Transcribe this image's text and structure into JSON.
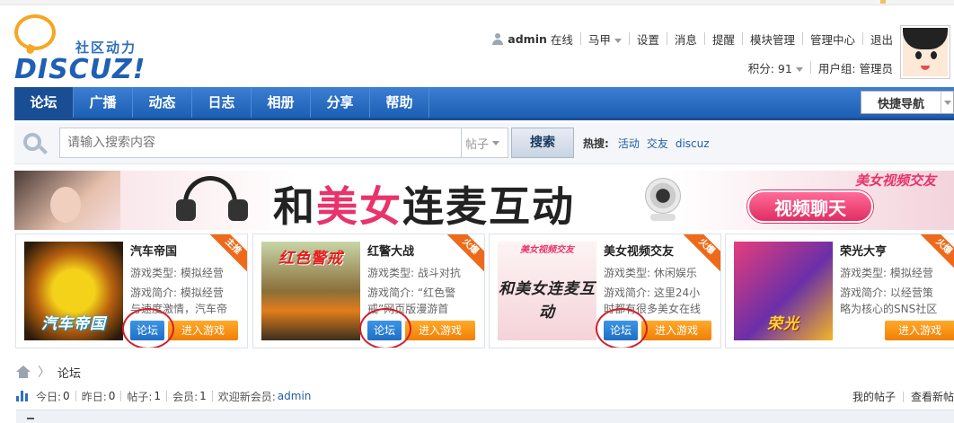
{
  "header": {
    "logo_slogan": "社区动力",
    "logo_word": "DISCUZ!",
    "user_nav": {
      "username": "admin",
      "online": "在线",
      "items": [
        {
          "label": "马甲",
          "dropdown": true
        },
        {
          "label": "设置"
        },
        {
          "label": "消息"
        },
        {
          "label": "提醒"
        },
        {
          "label": "模块管理"
        },
        {
          "label": "管理中心"
        },
        {
          "label": "退出"
        }
      ]
    },
    "credits_label": "积分: 91",
    "usergroup_label": "用户组: 管理员"
  },
  "nav": {
    "items": [
      "论坛",
      "广播",
      "动态",
      "日志",
      "相册",
      "分享",
      "帮助"
    ],
    "active_index": 0,
    "quick_nav": "快捷导航"
  },
  "search": {
    "placeholder": "请输入搜索内容",
    "type": "帖子",
    "button": "搜索",
    "hot_label": "热搜:",
    "hot_tags": [
      "活动",
      "交友",
      "discuz"
    ]
  },
  "banner": {
    "headline_a": "和",
    "headline_accent": "美女",
    "headline_b": "连麦互动",
    "tag": "美女视频交友",
    "pill": "视频聊天"
  },
  "games": [
    {
      "title": "汽车帝国",
      "badge": "主推",
      "thumb_text": "汽车帝国",
      "line1": "游戏类型: 模拟经营",
      "line2": "游戏简介: 模拟经营",
      "line3": "与速度激情，汽车帝",
      "forum_btn": "论坛",
      "play_btn": "进入游戏"
    },
    {
      "title": "红警大战",
      "badge": "火爆",
      "thumb_text": "红色警戒",
      "line1": "游戏类型: 战斗对抗",
      "line2": "游戏简介: “红色警",
      "line3": "戒”网页版漫游首",
      "forum_btn": "论坛",
      "play_btn": "进入游戏"
    },
    {
      "title": "美女视频交友",
      "badge": "火爆",
      "thumb_tag": "美女视频交友",
      "thumb_text": "和美女连麦互动",
      "line1": "游戏类型: 休闲娱乐",
      "line2": "游戏简介: 这里24小",
      "line3": "时都有很多美女在线",
      "forum_btn": "论坛",
      "play_btn": "进入游戏"
    },
    {
      "title": "荣光大亨",
      "badge": "火爆",
      "thumb_text": "荣光",
      "line1": "游戏类型: 模拟经营",
      "line2": "游戏简介: 以经营策",
      "line3": "略为核心的SNS社区",
      "play_btn": "进入游戏"
    }
  ],
  "breadcrumb": {
    "current": "论坛"
  },
  "stats": {
    "today_label": "今日:",
    "today": "0",
    "yesterday_label": "昨日:",
    "yesterday": "0",
    "posts_label": "帖子:",
    "posts": "1",
    "members_label": "会员:",
    "members": "1",
    "welcome_label": "欢迎新会员:",
    "newest": "admin"
  },
  "right_links": {
    "my_posts": "我的帖子",
    "view_new": "查看新帖"
  },
  "colors": {
    "nav_blue": "#1d5fb2",
    "accent_pink": "#e8336b",
    "play_orange": "#f07f05",
    "forum_blue": "#1f6fc4",
    "highlight_red": "#d21f2a"
  }
}
